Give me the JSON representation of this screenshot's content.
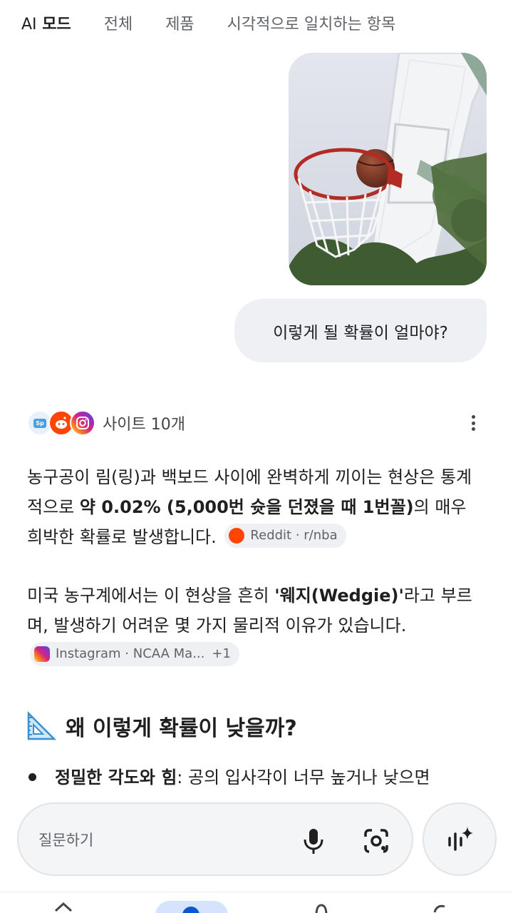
{
  "tabs": [
    {
      "label_ai": "AI",
      "label_rest": "모드",
      "active": true
    },
    {
      "label": "전체"
    },
    {
      "label": "제품"
    },
    {
      "label": "시각적으로 일치하는 항목"
    }
  ],
  "conversation": {
    "user_message": "이렇게 될 확률이 얼마야?"
  },
  "sources": {
    "label": "사이트 10개",
    "icons": [
      "sp-icon",
      "reddit-icon",
      "instagram-icon"
    ]
  },
  "answer": {
    "para1": {
      "text_a": "농구공이 림(링)과 백보드 사이에 완벽하게 끼이는 현상은 통계적으로 ",
      "bold": "약 0.02% (5,000번 슛을 던졌을 때 1번꼴)",
      "text_b": "의 매우 희박한 확률로 발생합니다.",
      "chip": "Reddit · r/nba"
    },
    "para2": {
      "text_a": "미국 농구계에서는 이 현상을 흔히 ",
      "bold": "'웨지(Wedgie)'",
      "text_b": "라고 부르며, 발생하기 어려운 몇 가지 물리적 이유가 있습니다.",
      "chip": "Instagram · NCAA Ma...",
      "chip_extra": "+1"
    },
    "heading": "왜 이렇게 확률이 낮을까?",
    "bullet": {
      "bold": "정밀한 각도와 힘",
      "text": ": 공의 입사각이 너무 높거나 낮으면"
    }
  },
  "input": {
    "placeholder": "질문하기"
  },
  "colors": {
    "accent": "#0b57d0",
    "bubble_bg": "#eef0f4",
    "chip_bg": "#eef0f3",
    "reddit": "#ff4500"
  }
}
